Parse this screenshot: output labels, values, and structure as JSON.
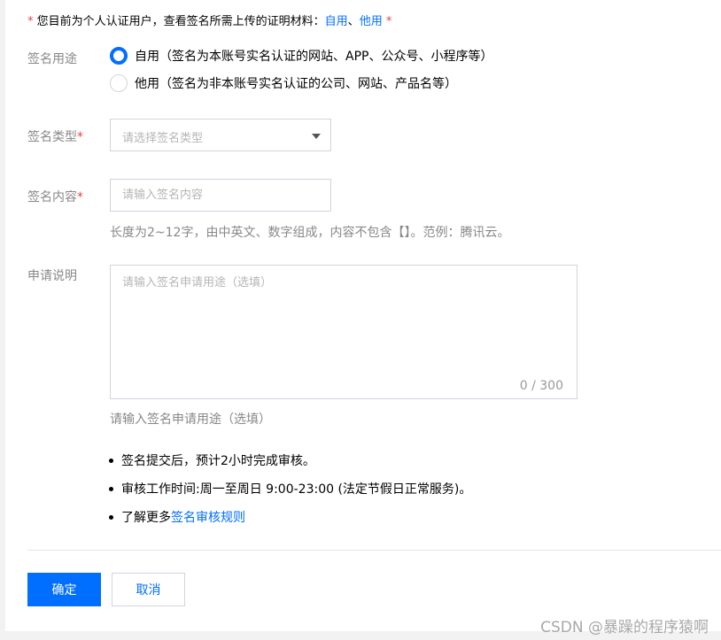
{
  "notice": {
    "star_left": "*",
    "text": "您目前为个人认证用户，查看签名所需上传的证明材料：",
    "link_self": "自用",
    "separator": "、",
    "link_other": "他用",
    "star_right": "*"
  },
  "usage": {
    "label": "签名用途",
    "options": [
      {
        "label": "自用（签名为本账号实名认证的网站、APP、公众号、小程序等）",
        "checked": true
      },
      {
        "label": "他用（签名为非本账号实名认证的公司、网站、产品名等）",
        "checked": false
      }
    ]
  },
  "sign_type": {
    "label": "签名类型",
    "required_mark": "*",
    "placeholder": "请选择签名类型"
  },
  "sign_content": {
    "label": "签名内容",
    "required_mark": "*",
    "placeholder": "请输入签名内容",
    "value": "",
    "hint": "长度为2~12字，由中英文、数字组成，内容不包含【】。范例：腾讯云。"
  },
  "description": {
    "label": "申请说明",
    "placeholder": "请输入签名申请用途（选填）",
    "value": "",
    "counter": "0 / 300",
    "hint": "请输入签名申请用途（选填）"
  },
  "tips": {
    "item1": "签名提交后，预计2小时完成审核。",
    "item2": "审核工作时间:周一至周日 9:00-23:00 (法定节假日正常服务)。",
    "item3_prefix": "了解更多",
    "item3_link": "签名审核规则"
  },
  "actions": {
    "confirm": "确定",
    "cancel": "取消"
  },
  "watermark": "CSDN @暴躁的程序猿啊",
  "colors": {
    "accent": "#006eff",
    "required": "#e54545",
    "border": "#cfd5de",
    "muted_text": "#888888"
  }
}
